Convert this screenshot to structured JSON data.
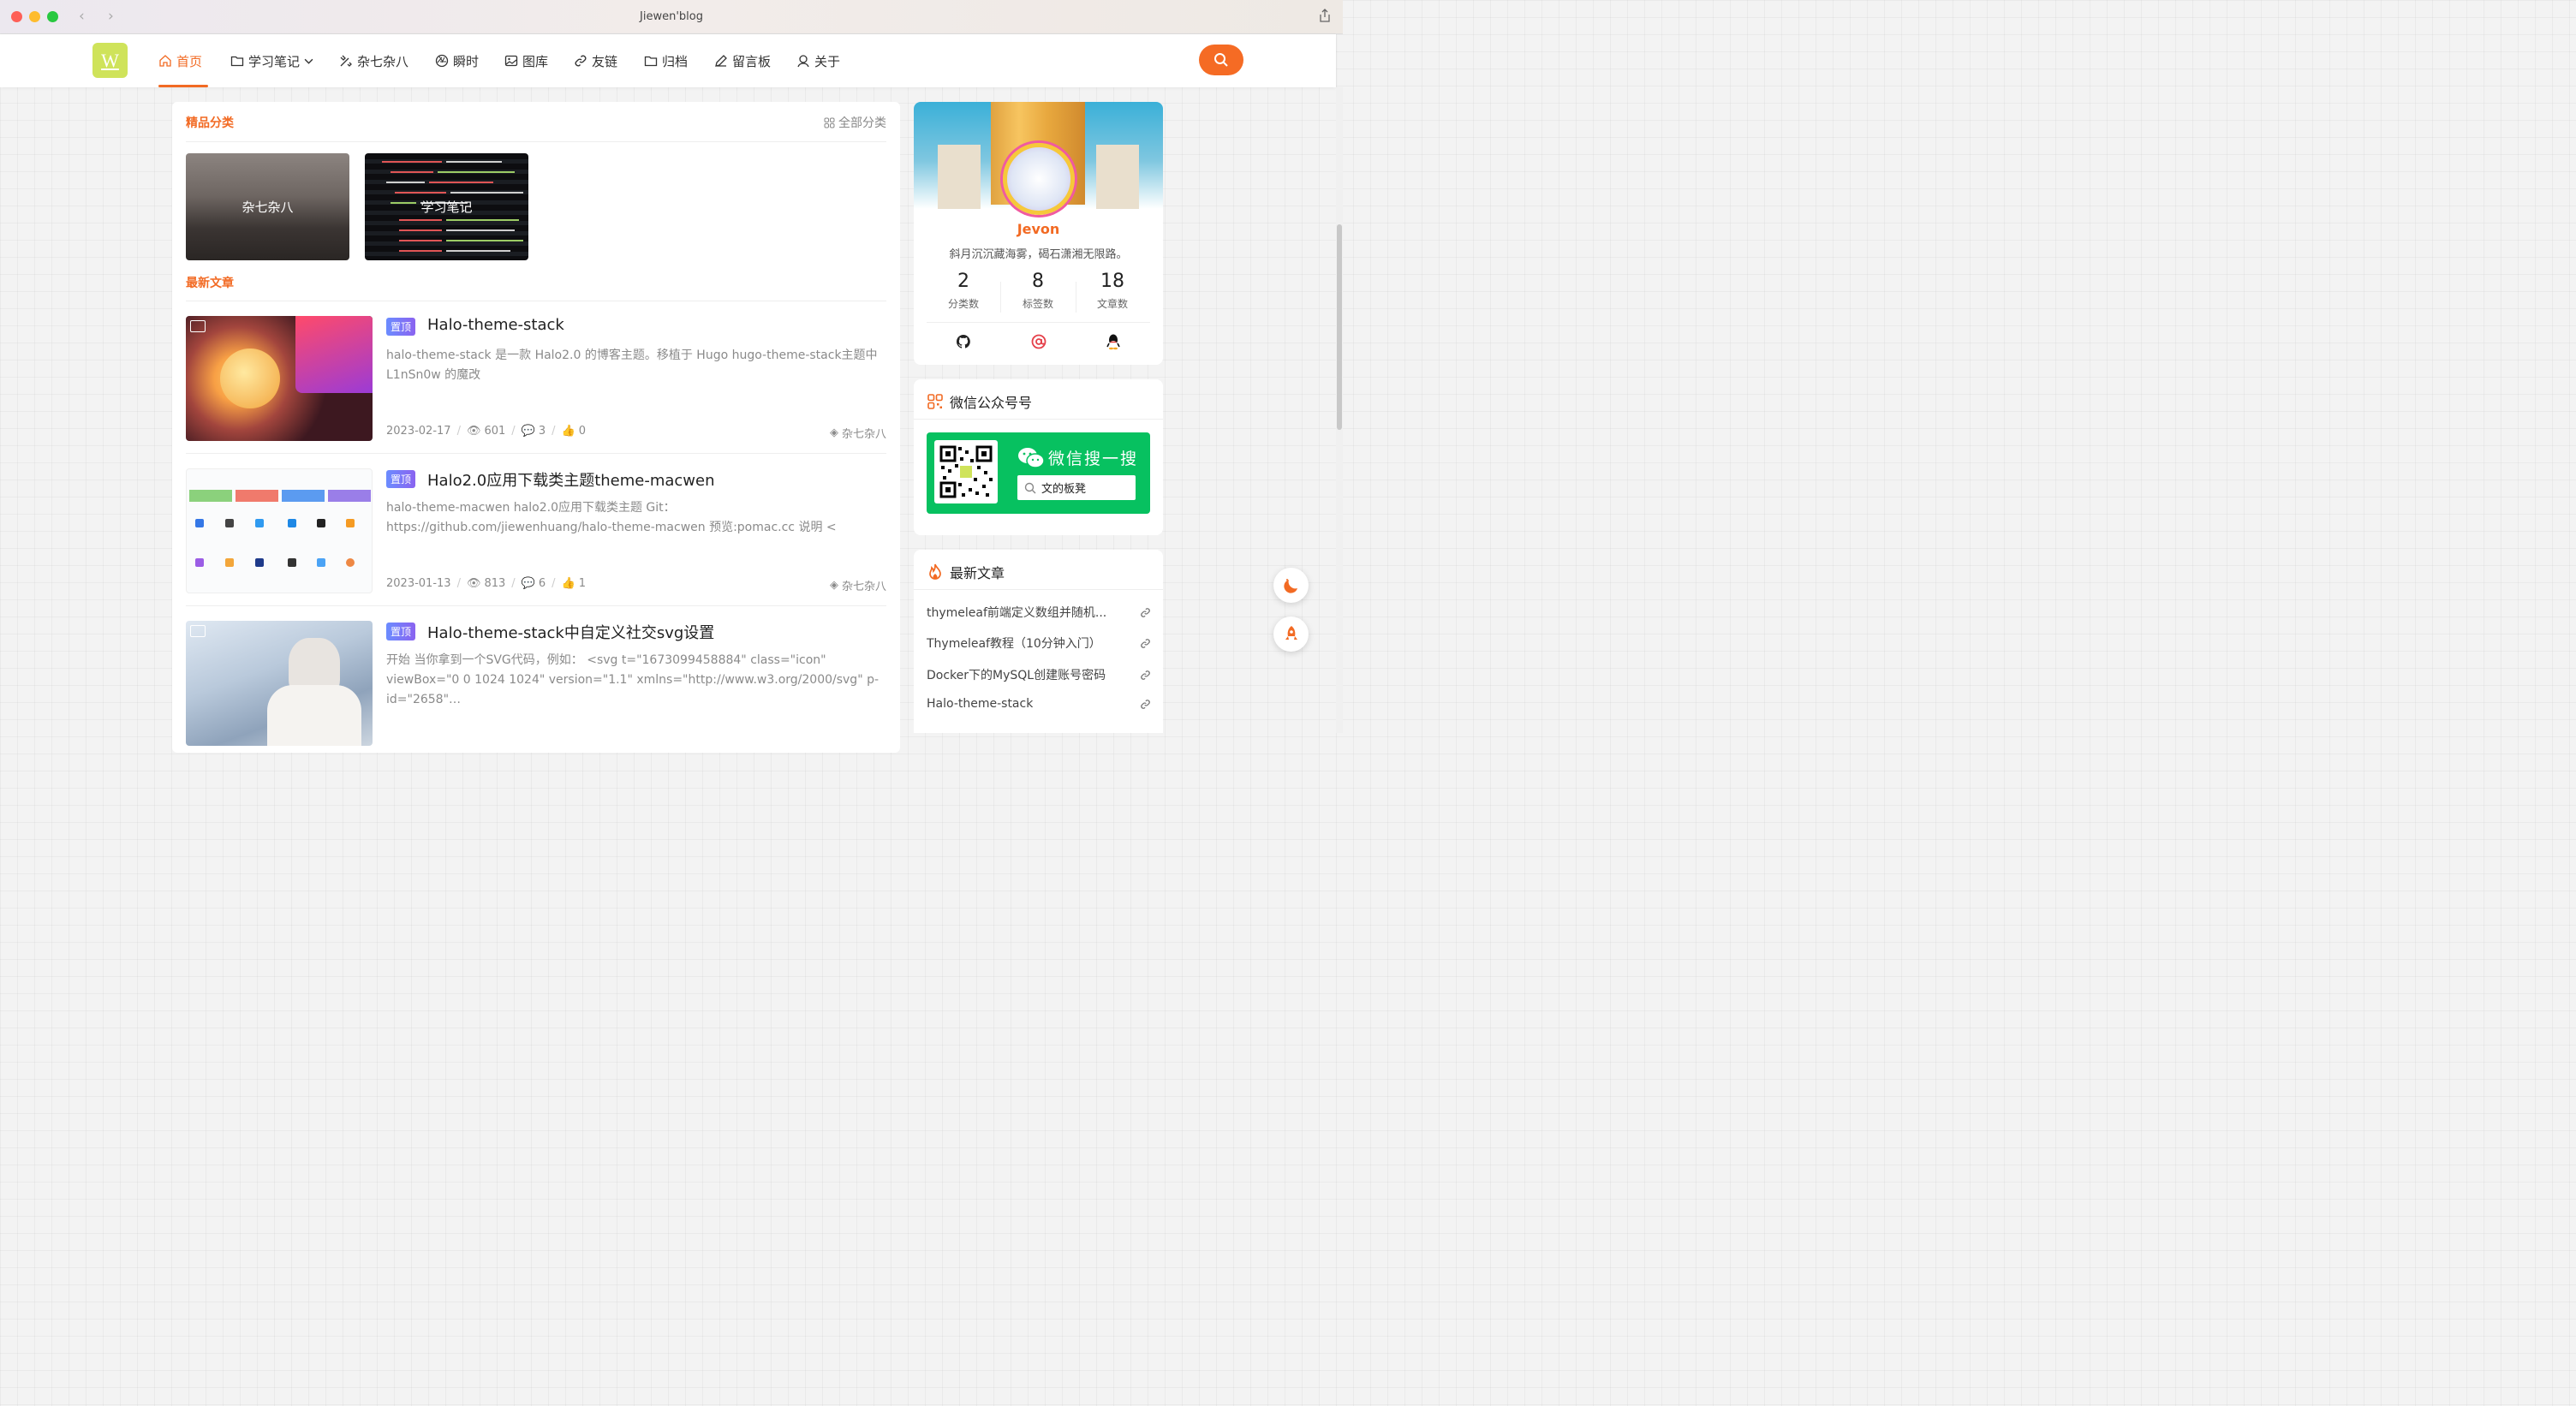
{
  "window": {
    "title": "Jiewen'blog"
  },
  "logo": {
    "text": "W"
  },
  "nav": {
    "items": [
      {
        "label": "首页",
        "icon": "home-icon"
      },
      {
        "label": "学习笔记",
        "icon": "folder-icon"
      },
      {
        "label": "杂七杂八",
        "icon": "tools-icon"
      },
      {
        "label": "瞬时",
        "icon": "aperture-icon"
      },
      {
        "label": "图库",
        "icon": "image-icon"
      },
      {
        "label": "友链",
        "icon": "link-icon"
      },
      {
        "label": "归档",
        "icon": "folder-icon"
      },
      {
        "label": "留言板",
        "icon": "pen-icon"
      },
      {
        "label": "关于",
        "icon": "user-icon"
      }
    ]
  },
  "featured": {
    "heading": "精品分类",
    "all_label": "全部分类",
    "cards": [
      {
        "label": "杂七杂八"
      },
      {
        "label": "学习笔记"
      }
    ]
  },
  "latest": {
    "heading": "最新文章",
    "pin_label": "置顶",
    "articles": [
      {
        "title": "Halo-theme-stack",
        "excerpt": "halo-theme-stack 是一款 Halo2.0 的博客主题。移植于 Hugo hugo-theme-stack主题中 L1nSn0w 的魔改",
        "date": "2023-02-17",
        "views": "601",
        "comments": "3",
        "likes": "0",
        "category": "杂七杂八"
      },
      {
        "title": "Halo2.0应用下载类主题theme-macwen",
        "excerpt": "halo-theme-macwen halo2.0应用下载类主题 Git：https://github.com/jiewenhuang/halo-theme-macwen 预览:pomac.cc 说明 <",
        "date": "2023-01-13",
        "views": "813",
        "comments": "6",
        "likes": "1",
        "category": "杂七杂八"
      },
      {
        "title": "Halo-theme-stack中自定义社交svg设置",
        "excerpt": "开始 当你拿到一个SVG代码，例如： <svg t=\"1673099458884\" class=\"icon\" viewBox=\"0 0 1024 1024\" version=\"1.1\" xmlns=\"http://www.w3.org/2000/svg\" p-id=\"2658\"…"
      }
    ]
  },
  "profile": {
    "name": "Jevon",
    "motto": "斜月沉沉藏海雾，碣石潇湘无限路。",
    "stats": [
      {
        "value": "2",
        "label": "分类数"
      },
      {
        "value": "8",
        "label": "标签数"
      },
      {
        "value": "18",
        "label": "文章数"
      }
    ],
    "socials": [
      "github-icon",
      "email-icon",
      "qq-icon"
    ]
  },
  "wechat": {
    "heading": "微信公众号号",
    "search_title": "微信搜一搜",
    "search_value": "文的板凳"
  },
  "recent": {
    "heading": "最新文章",
    "items": [
      {
        "label": "thymeleaf前端定义数组并随机..."
      },
      {
        "label": "Thymeleaf教程（10分钟入门）"
      },
      {
        "label": "Docker下的MySQL创建账号密码"
      },
      {
        "label": "Halo-theme-stack"
      }
    ]
  },
  "colors": {
    "accent": "#f26a23",
    "wechat_green": "#07c160"
  }
}
